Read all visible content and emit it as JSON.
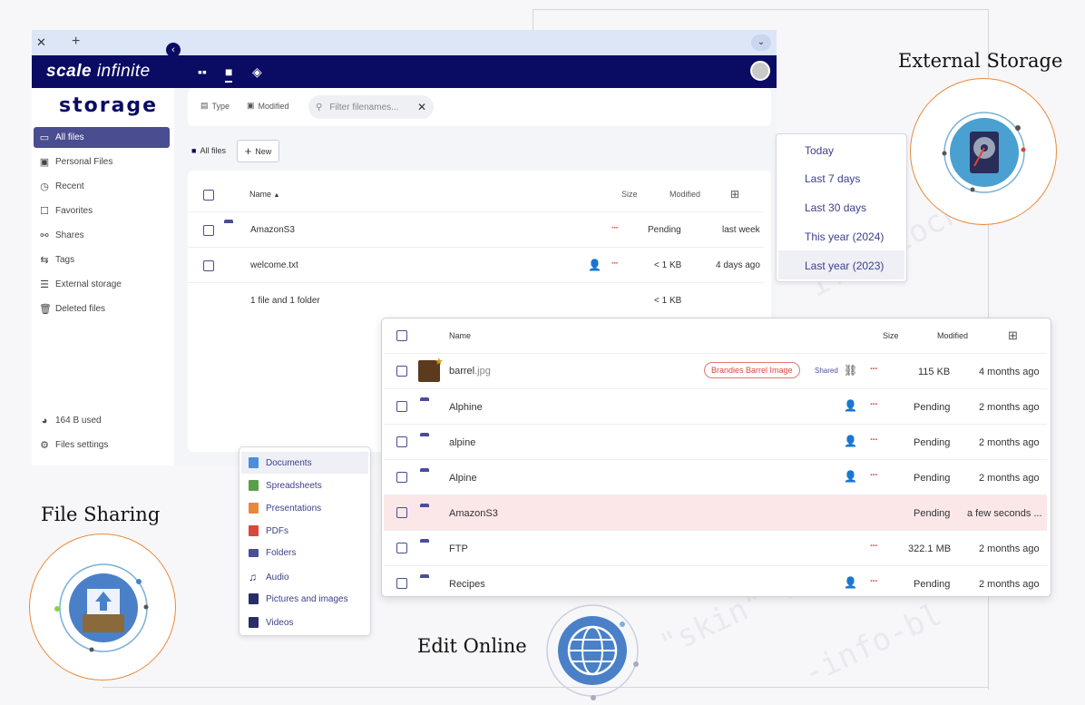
{
  "browser": {
    "tab_close": "✕",
    "tab_new": "+",
    "tab_menu": "⌄"
  },
  "topbar": {
    "brand_main": "scale",
    "brand_sub": "infinite"
  },
  "sidebar": {
    "logo": "storage",
    "items": [
      {
        "label": "All files",
        "icon": "folder-icon"
      },
      {
        "label": "Personal Files",
        "icon": "person-files-icon"
      },
      {
        "label": "Recent",
        "icon": "recent-icon"
      },
      {
        "label": "Favorites",
        "icon": "favorites-icon"
      },
      {
        "label": "Shares",
        "icon": "share-icon"
      },
      {
        "label": "Tags",
        "icon": "tags-icon"
      },
      {
        "label": "External storage",
        "icon": "external-storage-icon"
      },
      {
        "label": "Deleted files",
        "icon": "trash-icon"
      }
    ],
    "usage": "164 B used",
    "settings": "Files settings"
  },
  "filters": {
    "type_label": "Type",
    "modified_label": "Modified",
    "search_placeholder": "Filter filenames...",
    "clear": "✕"
  },
  "breadcrumb": {
    "all_files": "All files",
    "new_button": "New"
  },
  "table": {
    "headers": {
      "name": "Name",
      "size": "Size",
      "modified": "Modified"
    },
    "sort_arrow": "▲",
    "rows": [
      {
        "name": "AmazonS3",
        "size": "Pending",
        "modified": "last week"
      },
      {
        "name": "welcome.txt",
        "size": "< 1 KB",
        "modified": "4 days ago"
      }
    ],
    "summary": {
      "label": "1 file and 1 folder",
      "size": "< 1 KB"
    }
  },
  "date_menu": {
    "options": [
      "Today",
      "Last 7 days",
      "Last 30 days",
      "This year (2024)",
      "Last year (2023)"
    ]
  },
  "type_menu": {
    "options": [
      {
        "label": "Documents",
        "color": "#4a8fdb"
      },
      {
        "label": "Spreadsheets",
        "color": "#5aa04a"
      },
      {
        "label": "Presentations",
        "color": "#e58a3a"
      },
      {
        "label": "PDFs",
        "color": "#d9463b"
      },
      {
        "label": "Folders",
        "color": "#4a4d9a"
      },
      {
        "label": "Audio",
        "color": "#2a2c6a"
      },
      {
        "label": "Pictures and images",
        "color": "#2a2c6a"
      },
      {
        "label": "Videos",
        "color": "#2a2c6a"
      }
    ]
  },
  "panel2": {
    "headers": {
      "name": "Name",
      "size": "Size",
      "modified": "Modified"
    },
    "rows": [
      {
        "name": "barrel",
        "ext": ".jpg",
        "tag": "Brandies Barrel Image",
        "shared": "Shared",
        "size": "115 KB",
        "modified": "4 months ago"
      },
      {
        "name": "Alphine",
        "size": "Pending",
        "modified": "2 months ago"
      },
      {
        "name": "alpine",
        "size": "Pending",
        "modified": "2 months ago"
      },
      {
        "name": "Alpine",
        "size": "Pending",
        "modified": "2 months ago"
      },
      {
        "name": "AmazonS3",
        "size": "Pending",
        "modified": "a few seconds ..."
      },
      {
        "name": "FTP",
        "size": "322.1 MB",
        "modified": "2 months ago"
      },
      {
        "name": "Recipes",
        "size": "Pending",
        "modified": "2 months ago"
      }
    ]
  },
  "features": {
    "external_storage": "External Storage",
    "file_sharing": "File Sharing",
    "edit_online": "Edit Online"
  },
  "colors": {
    "navy": "#0a0b63",
    "accent": "#4a4d9a",
    "orange_ring": "#e88a3a",
    "highlight_row": "#fbe7e7"
  }
}
